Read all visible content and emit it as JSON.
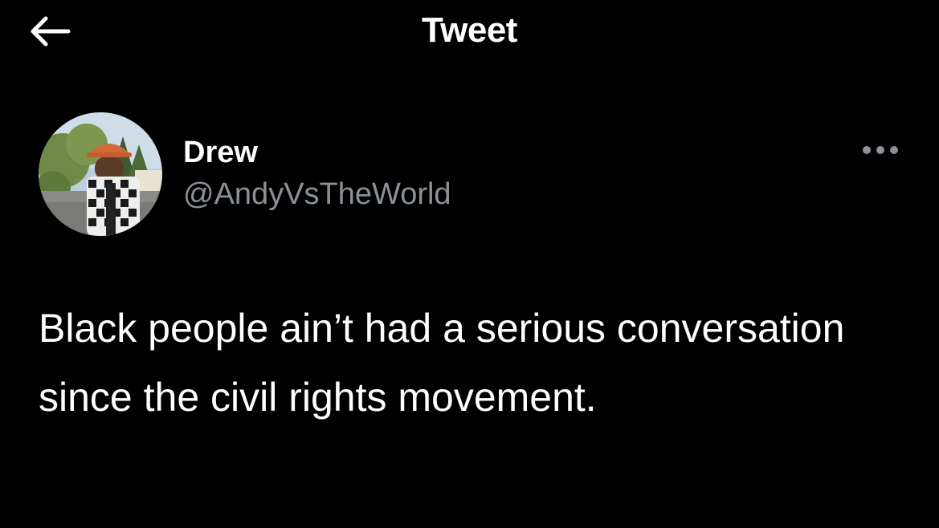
{
  "header": {
    "title": "Tweet",
    "back_icon": "arrow-left-icon"
  },
  "tweet": {
    "author": {
      "display_name": "Drew",
      "handle": "@AndyVsTheWorld",
      "avatar_icon": "user-avatar"
    },
    "more_icon": "more-horizontal-icon",
    "text": "Black people ain’t had a serious conversation since the civil rights movement."
  },
  "colors": {
    "background": "#000000",
    "primary_text": "#ffffff",
    "secondary_text": "#8b9197"
  }
}
